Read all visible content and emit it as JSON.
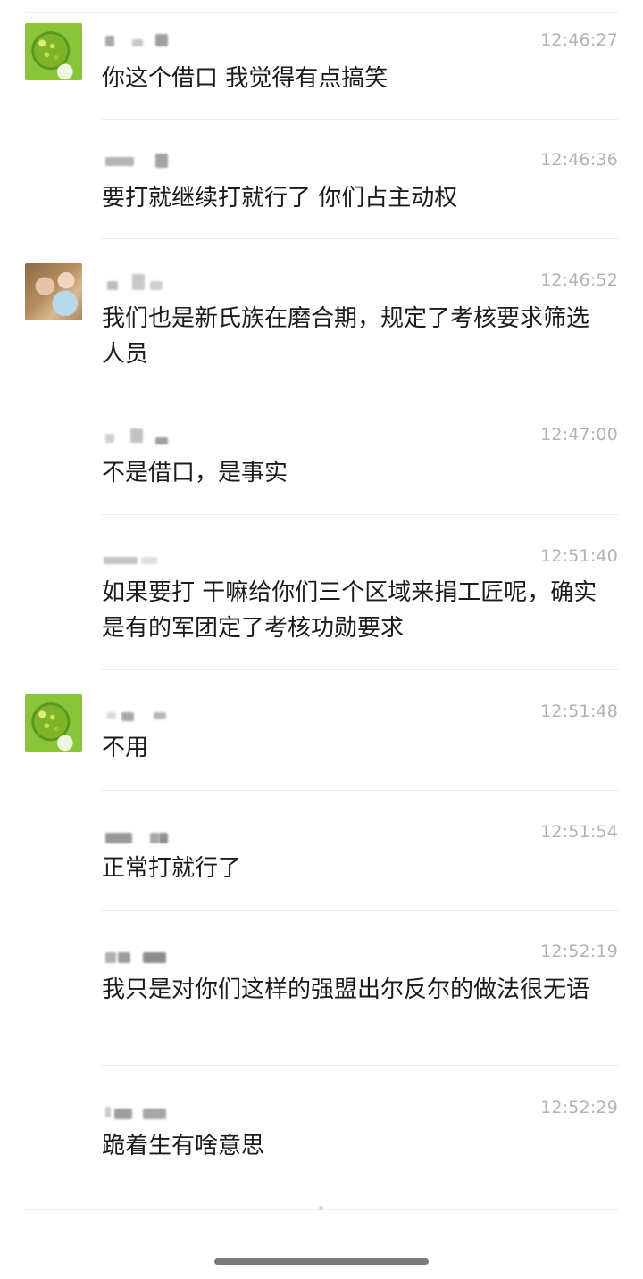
{
  "messages": [
    {
      "avatar": "leaf-avatar",
      "time": "12:46:27",
      "text": "你这个借口 我觉得有点搞笑"
    },
    {
      "avatar": null,
      "time": "12:46:36",
      "text": "要打就继续打就行了 你们占主动权"
    },
    {
      "avatar": "photo-avatar",
      "time": "12:46:52",
      "text": "我们也是新氏族在磨合期，规定了考核要求筛选人员"
    },
    {
      "avatar": null,
      "time": "12:47:00",
      "text": "不是借口，是事实"
    },
    {
      "avatar": null,
      "time": "12:51:40",
      "text": "如果要打 干嘛给你们三个区域来捐工匠呢，确实是有的军团定了考核功勋要求"
    },
    {
      "avatar": "leaf-avatar",
      "time": "12:51:48",
      "text": "不用"
    },
    {
      "avatar": null,
      "time": "12:51:54",
      "text": "正常打就行了"
    },
    {
      "avatar": null,
      "time": "12:52:19",
      "text": "我只是对你们这样的强盟出尔反尔的做法很无语"
    },
    {
      "avatar": null,
      "time": "12:52:29",
      "text": "跪着生有啥意思"
    }
  ],
  "colors": {
    "background": "#ffffff",
    "text": "#1b1b1b",
    "timestamp": "#b3b3b3",
    "divider": "#ececec"
  }
}
